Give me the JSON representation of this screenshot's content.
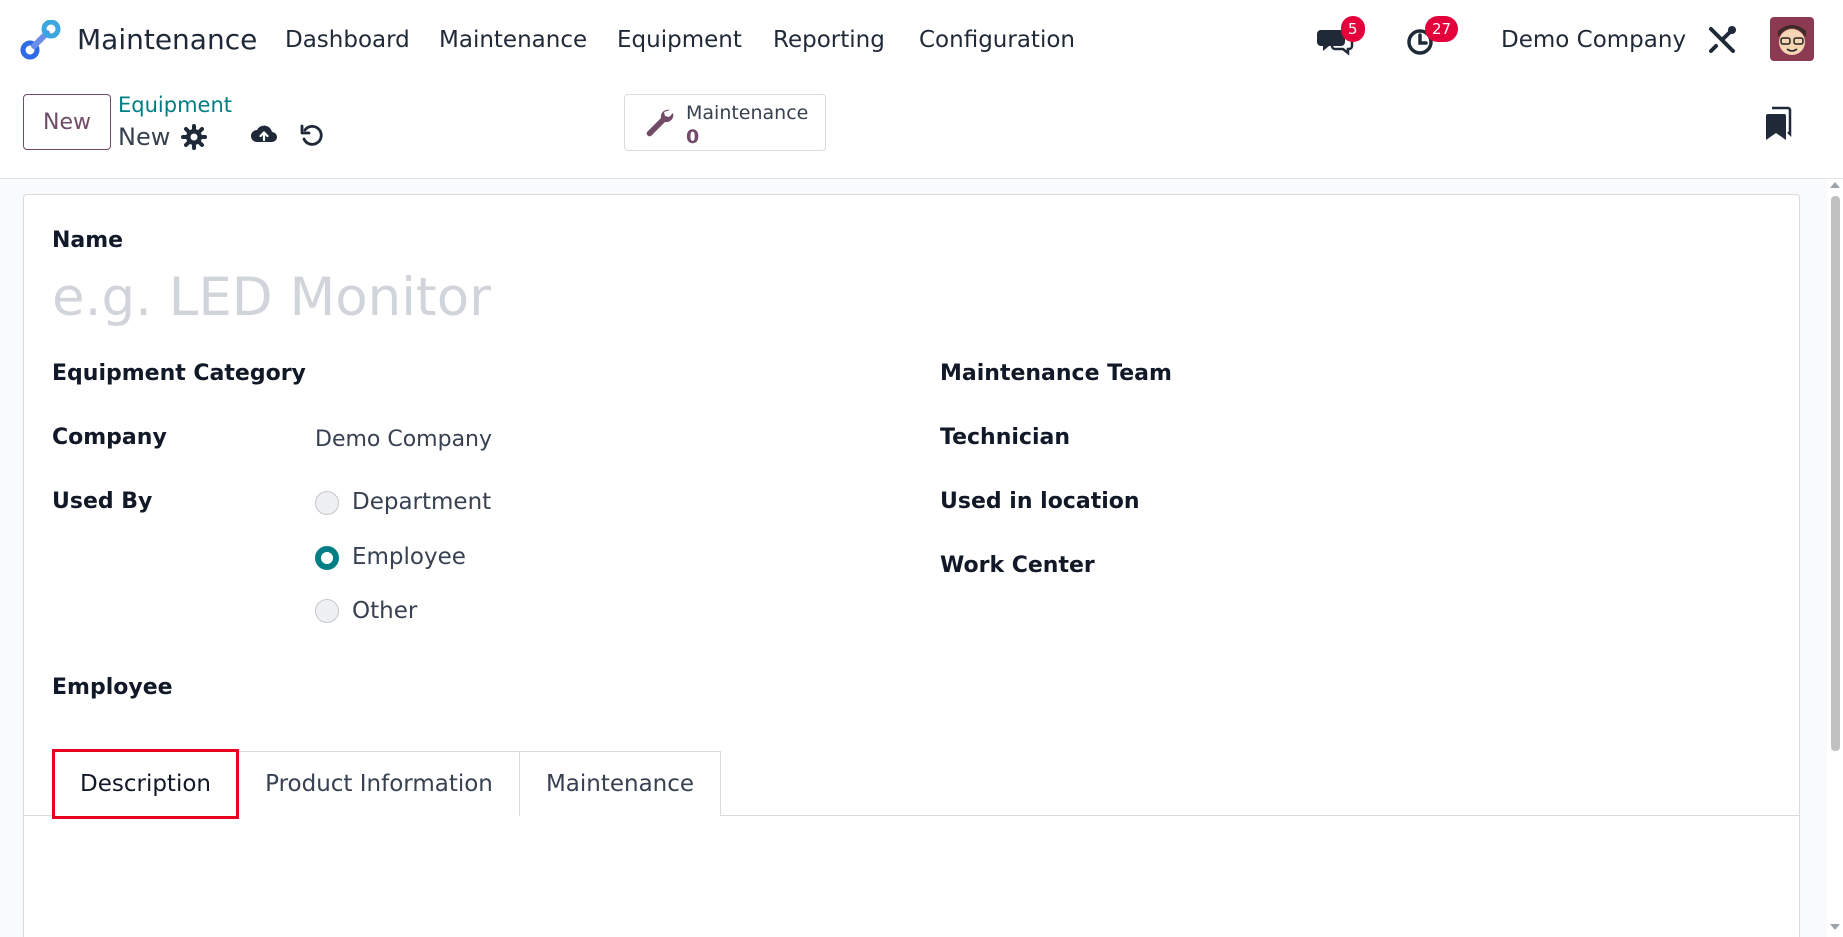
{
  "navbar": {
    "app_name": "Maintenance",
    "menu": [
      "Dashboard",
      "Maintenance",
      "Equipment",
      "Reporting",
      "Configuration"
    ],
    "messages_badge": "5",
    "activities_badge": "27",
    "company": "Demo Company",
    "icons": {
      "app": "maintenance-logo-icon",
      "messages": "chat-bubbles-icon",
      "activities": "clock-icon",
      "settings": "tools-icon",
      "avatar": "user-avatar"
    }
  },
  "control_panel": {
    "new_button": "New",
    "breadcrumb_parent": "Equipment",
    "breadcrumb_current": "New",
    "smart_button": {
      "label": "Maintenance",
      "value": "0",
      "icon": "wrench-icon"
    }
  },
  "form": {
    "name_label": "Name",
    "name_placeholder": "e.g. LED Monitor",
    "name_value": "",
    "left_fields": {
      "equipment_category": "Equipment Category",
      "company": "Company",
      "company_value": "Demo Company",
      "used_by": "Used By",
      "used_by_options": [
        "Department",
        "Employee",
        "Other"
      ],
      "used_by_selected": "Employee",
      "employee": "Employee"
    },
    "right_fields": {
      "maintenance_team": "Maintenance Team",
      "technician": "Technician",
      "used_in_location": "Used in location",
      "work_center": "Work Center"
    },
    "tabs": [
      "Description",
      "Product Information",
      "Maintenance"
    ],
    "active_tab": "Description"
  },
  "colors": {
    "brand": "#714b67",
    "accent": "#017e84",
    "badge": "#e4003a",
    "highlight": "#e8001c"
  }
}
